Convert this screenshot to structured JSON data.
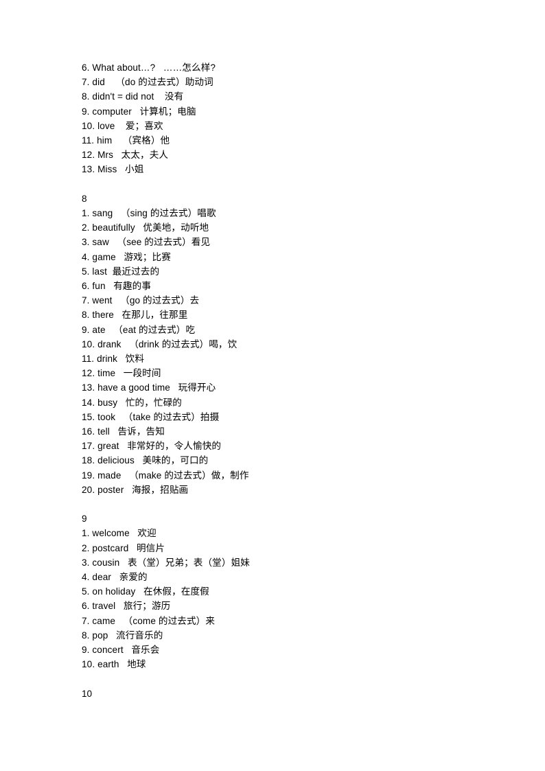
{
  "document": {
    "page_background": "#ffffff",
    "text_color": "#000000",
    "blocks": [
      {
        "section_label": null,
        "lines": [
          "6. What about…?   ……怎么样?",
          "7. did    （do 的过去式）助动词",
          "8. didn't = did not    没有",
          "9. computer   计算机；电脑",
          "10. love    爱；喜欢",
          "11. him    （宾格）他",
          "12. Mrs   太太，夫人",
          "13. Miss   小姐"
        ]
      },
      {
        "section_label": "8",
        "lines": [
          "1. sang   （sing 的过去式）唱歌",
          "2. beautifully   优美地，动听地",
          "3. saw   （see 的过去式）看见",
          "4. game   游戏；比赛",
          "5. last  最近过去的",
          "6. fun   有趣的事",
          "7. went   （go 的过去式）去",
          "8. there   在那儿，往那里",
          "9. ate   （eat 的过去式）吃",
          "10. drank   （drink 的过去式）喝，饮",
          "11. drink   饮料",
          "12. time   一段时间",
          "13. have a good time   玩得开心",
          "14. busy   忙的，忙碌的",
          "15. took   （take 的过去式）拍摄",
          "16. tell   告诉，告知",
          "17. great   非常好的，令人愉快的",
          "18. delicious   美味的，可口的",
          "19. made   （make 的过去式）做，制作",
          "20. poster   海报，招贴画"
        ]
      },
      {
        "section_label": "9",
        "lines": [
          "1. welcome   欢迎",
          "2. postcard   明信片",
          "3. cousin   表（堂）兄弟；表（堂）姐妹",
          "4. dear   亲爱的",
          "5. on holiday   在休假，在度假",
          "6. travel   旅行；游历",
          "7. came   （come 的过去式）来",
          "8. pop   流行音乐的",
          "9. concert   音乐会",
          "10. earth   地球"
        ]
      },
      {
        "section_label": "10",
        "lines": []
      }
    ]
  }
}
